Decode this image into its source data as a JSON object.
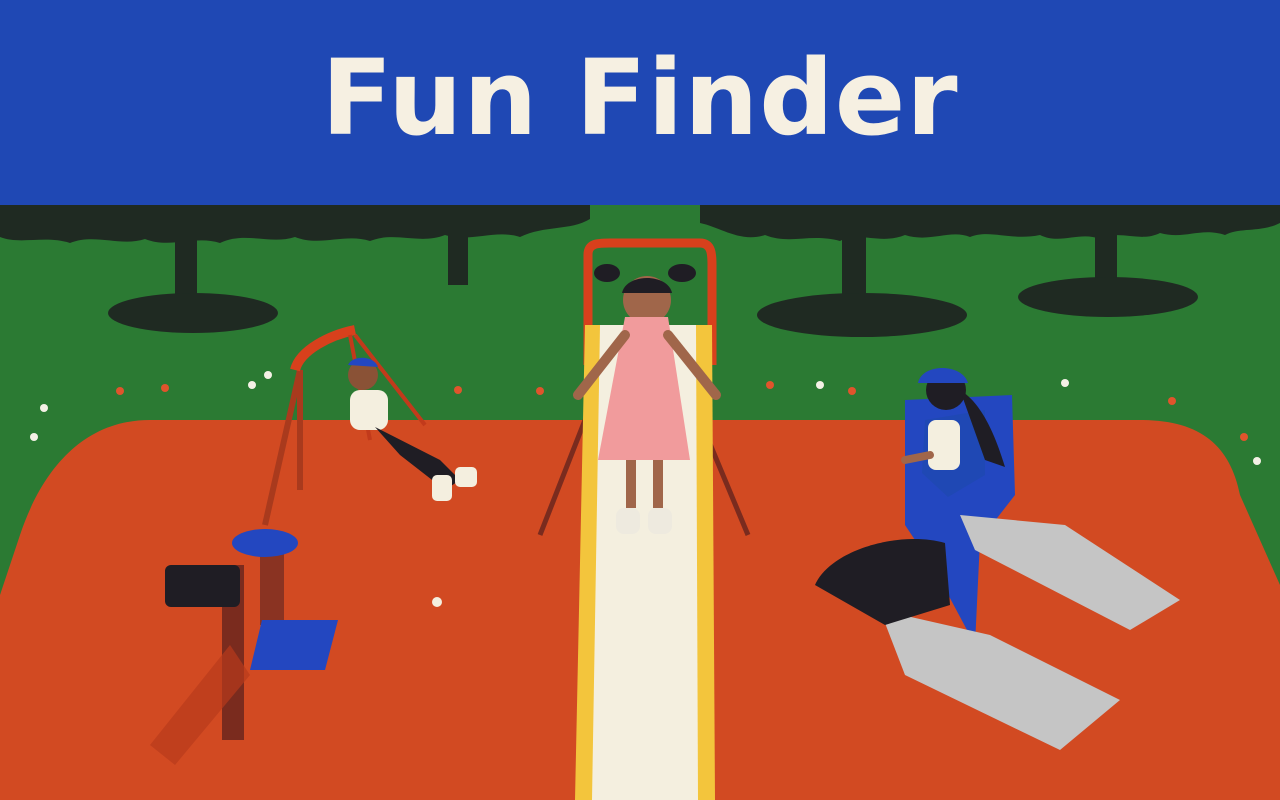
{
  "banner": {
    "title": "Fun Finder"
  },
  "colors": {
    "banner": "#1f48b4",
    "title_text": "#f6f0e2",
    "grass": "#2b7a33",
    "ground": "#d24a22",
    "tree": "#1f2a22",
    "slide_frame": "#d8401c",
    "slide_rail": "#f3c53c",
    "slide_bed": "#f4efdf",
    "dress": "#f19b9c",
    "cap_blue": "#2347c0",
    "step_gray": "#c5c5c5"
  },
  "icons": [
    "tree-icon",
    "swing-icon",
    "slide-icon",
    "seesaw-icon",
    "climbing-block-icon",
    "flower-icon"
  ]
}
